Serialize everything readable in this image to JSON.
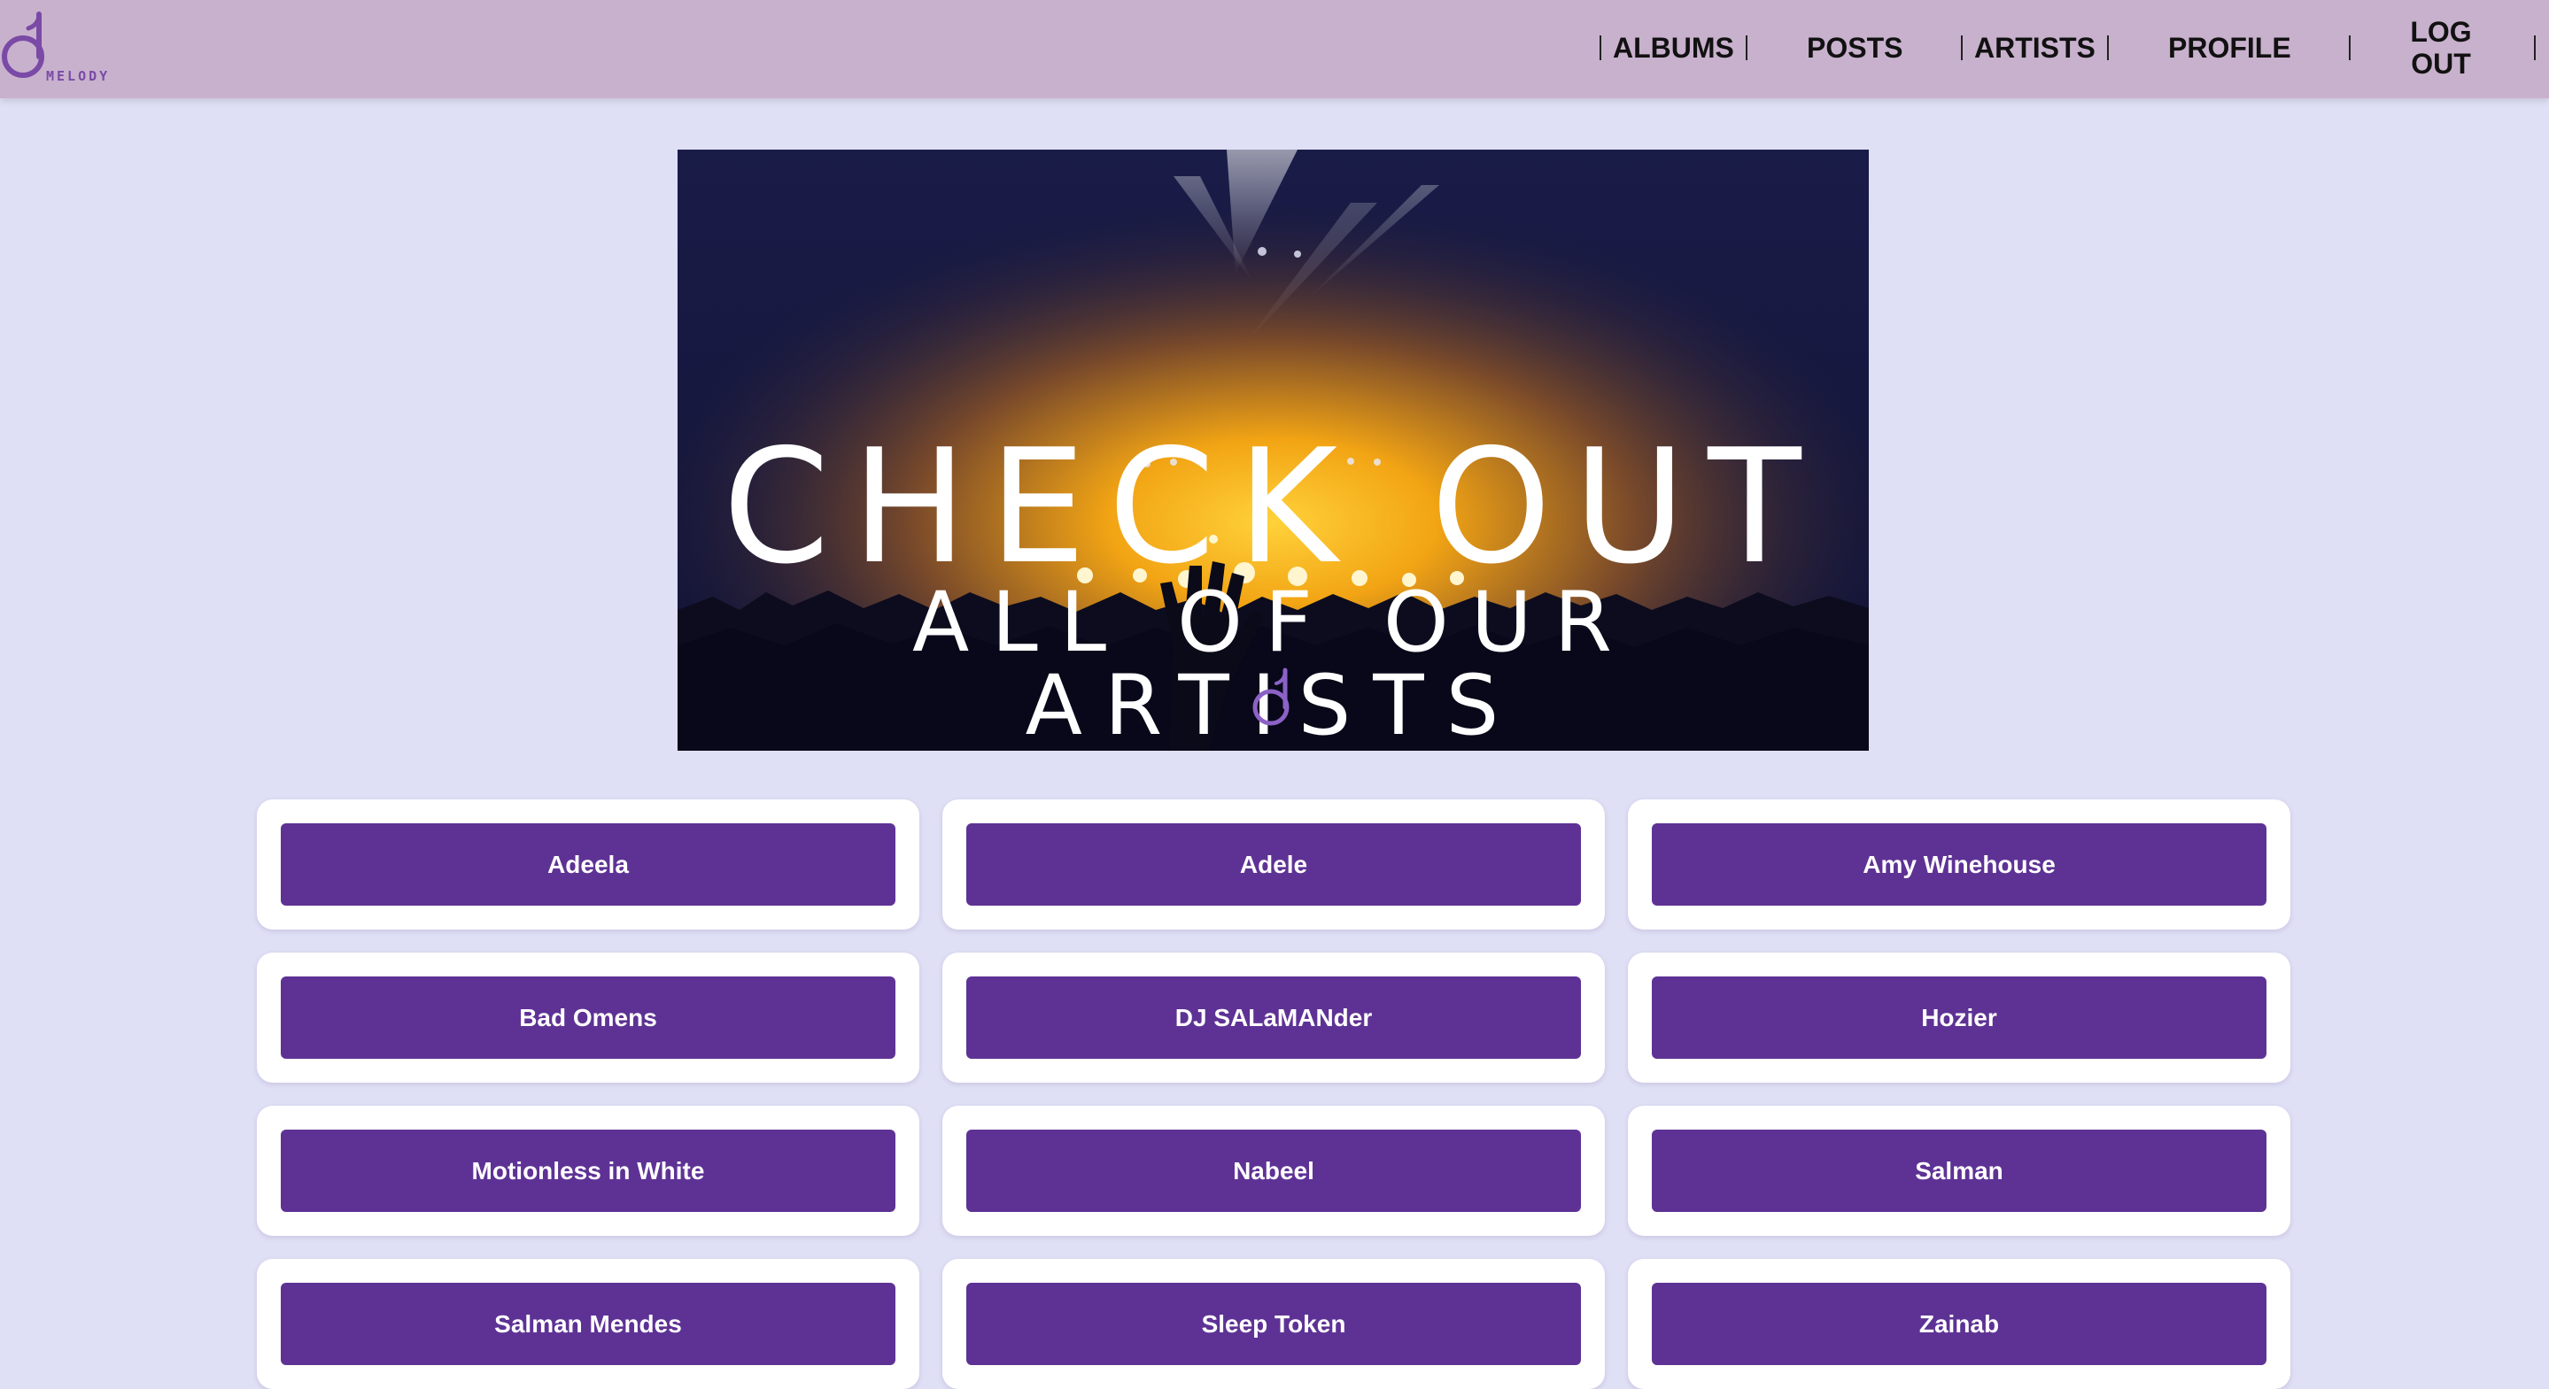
{
  "header": {
    "logo_text": "MELODY",
    "nav": {
      "albums": "ALBUMS",
      "posts": "POSTS",
      "artists": "ARTISTS",
      "profile": "PROFILE",
      "logout_line1": "LOG",
      "logout_line2": "OUT"
    }
  },
  "banner": {
    "title_line1": "CHECK OUT",
    "title_line2": "ALL OF OUR ARTISTS"
  },
  "artists": [
    "Adeela",
    "Adele",
    "Amy Winehouse",
    "Bad Omens",
    "DJ SALaMANder",
    "Hozier",
    "Motionless in White",
    "Nabeel",
    "Salman",
    "Salman Mendes",
    "Sleep Token",
    "Zainab"
  ],
  "colors": {
    "navbar": "#c8b1cd",
    "background": "#dfdff5",
    "button": "#5e3295",
    "logo": "#7a4aa6"
  }
}
